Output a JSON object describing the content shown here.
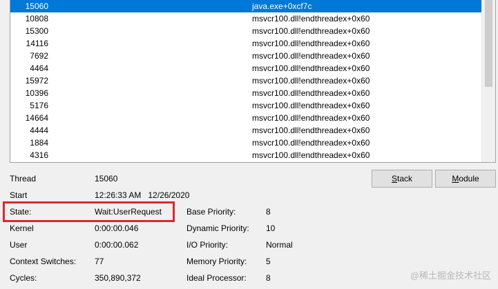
{
  "threads": [
    {
      "tid": "15060",
      "start_address": "java.exe+0xcf7c",
      "selected": true
    },
    {
      "tid": "10808",
      "start_address": "msvcr100.dll!endthreadex+0x60"
    },
    {
      "tid": "15300",
      "start_address": "msvcr100.dll!endthreadex+0x60"
    },
    {
      "tid": "14116",
      "start_address": "msvcr100.dll!endthreadex+0x60"
    },
    {
      "tid": "7692",
      "start_address": "msvcr100.dll!endthreadex+0x60"
    },
    {
      "tid": "4464",
      "start_address": "msvcr100.dll!endthreadex+0x60"
    },
    {
      "tid": "15972",
      "start_address": "msvcr100.dll!endthreadex+0x60"
    },
    {
      "tid": "10396",
      "start_address": "msvcr100.dll!endthreadex+0x60"
    },
    {
      "tid": "5176",
      "start_address": "msvcr100.dll!endthreadex+0x60"
    },
    {
      "tid": "14664",
      "start_address": "msvcr100.dll!endthreadex+0x60"
    },
    {
      "tid": "4444",
      "start_address": "msvcr100.dll!endthreadex+0x60"
    },
    {
      "tid": "1884",
      "start_address": "msvcr100.dll!endthreadex+0x60"
    },
    {
      "tid": "4316",
      "start_address": "msvcr100.dll!endthreadex+0x60"
    }
  ],
  "details": {
    "thread_label": "Thread",
    "thread_value": "15060",
    "start_label": "Start",
    "start_value": "12:26:33 AM   12/26/2020",
    "state_label": "State:",
    "state_value": "Wait:UserRequest",
    "kernel_label": "Kernel",
    "kernel_value": "0:00:00.046",
    "user_label": "User",
    "user_value": "0:00:00.062",
    "ctx_label": "Context Switches:",
    "ctx_value": "77",
    "cycles_label": "Cycles:",
    "cycles_value": "350,890,372"
  },
  "priority": {
    "base_label": "Base Priority:",
    "base_value": "8",
    "dynamic_label": "Dynamic Priority:",
    "dynamic_value": "10",
    "io_label": "I/O Priority:",
    "io_value": "Normal",
    "memory_label": "Memory Priority:",
    "memory_value": "5",
    "ideal_label": "Ideal Processor:",
    "ideal_value": "8"
  },
  "buttons": {
    "stack_accel": "S",
    "stack_rest": "tack",
    "module_accel": "M",
    "module_rest": "odule"
  },
  "watermark": "@稀土掘金技术社区"
}
